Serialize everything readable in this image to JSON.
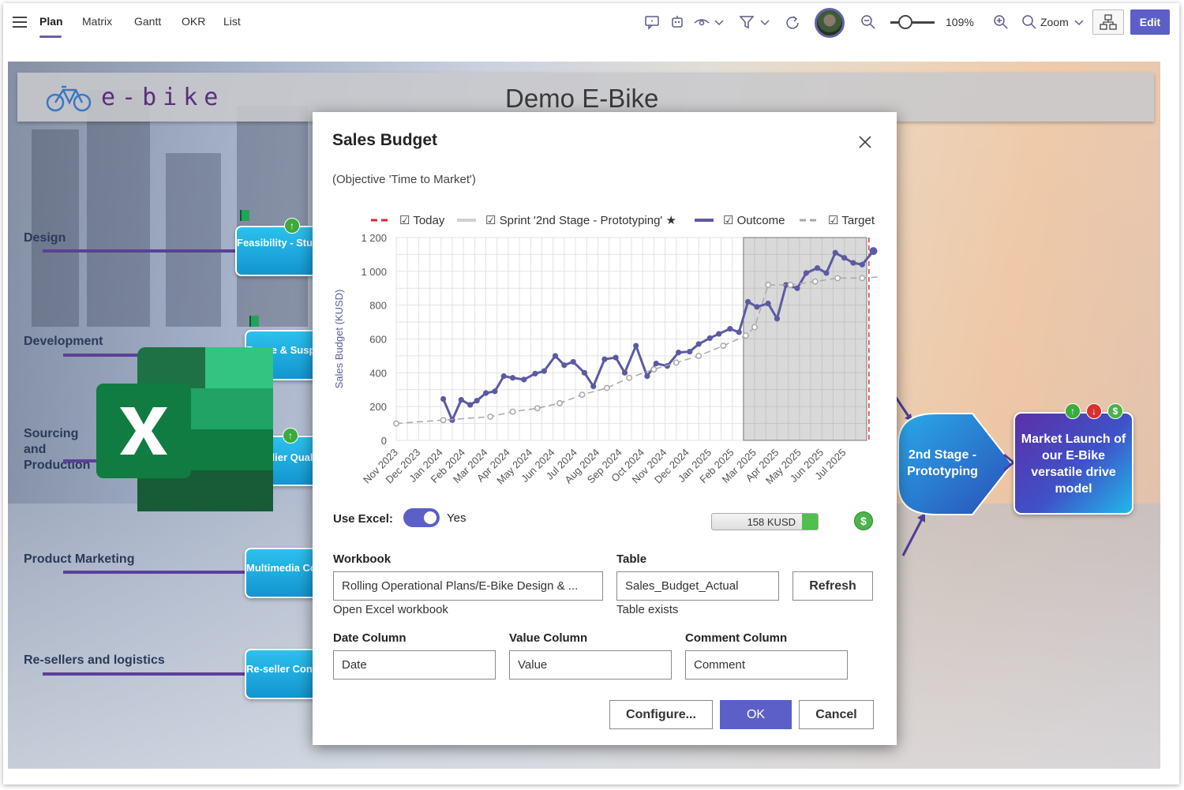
{
  "toolbar": {
    "tabs": [
      "Plan",
      "Matrix",
      "Gantt",
      "OKR",
      "List"
    ],
    "zoom_value": "109%",
    "zoom_label": "Zoom",
    "edit_label": "Edit"
  },
  "canvas": {
    "logo_text": "e-bike",
    "title": "Demo E-Bike",
    "lanes": [
      "Design",
      "Development",
      "Sourcing and Production",
      "Product Marketing",
      "Re-sellers and logistics"
    ],
    "cards": [
      {
        "text": "Feasibility - Study Prototyping"
      },
      {
        "text": "Frame & Suspension"
      },
      {
        "text": "Supplier Qualification"
      },
      {
        "text": "Multimedia Content"
      },
      {
        "text": "Re-seller Contracts"
      }
    ],
    "stage_node": "2nd Stage - Prototyping",
    "launch_node": "Market Launch of our E-Bike versatile drive model",
    "colors": {
      "card": "#1fa8df",
      "lane_line": "#5d3f99",
      "launch_start": "#5c2fa8",
      "launch_end": "#21b8ea"
    }
  },
  "dialog": {
    "title": "Sales Budget",
    "subtitle": "(Objective 'Time to Market')",
    "close_icon": "close-icon",
    "use_excel_label": "Use Excel:",
    "use_excel_value": "Yes",
    "budget_value": "158 KUSD",
    "budget_fill_fraction": 0.15,
    "workbook_label": "Workbook",
    "workbook_value": "Rolling Operational Plans/E-Bike Design & ...",
    "open_workbook_link": "Open Excel workbook",
    "table_label": "Table",
    "table_value": "Sales_Budget_Actual",
    "table_status": "Table exists",
    "refresh_label": "Refresh",
    "date_col_label": "Date Column",
    "date_col_value": "Date",
    "value_col_label": "Value Column",
    "value_col_value": "Value",
    "comment_col_label": "Comment Column",
    "comment_col_value": "Comment",
    "configure_label": "Configure...",
    "ok_label": "OK",
    "cancel_label": "Cancel"
  },
  "chart_data": {
    "type": "line",
    "ylabel": "Sales Budget (KUSD)",
    "ylim": [
      0,
      1200
    ],
    "yticks": [
      "0",
      "200",
      "400",
      "600",
      "800",
      "1 000",
      "1 200"
    ],
    "categories": [
      "Nov 2023",
      "Dec 2023",
      "Jan 2024",
      "Feb 2024",
      "Mar 2024",
      "Apr 2024",
      "May 2024",
      "Jun 2024",
      "Jul 2024",
      "Aug 2024",
      "Sep 2024",
      "Oct 2024",
      "Nov 2024",
      "Dec 2024",
      "Jan 2025",
      "Feb 2025",
      "Mar 2025",
      "Apr 2025",
      "May 2025",
      "Jun 2025",
      "Jul 2025"
    ],
    "legend": [
      {
        "label": "☑ Today",
        "color": "#d9252f",
        "style": "dashed"
      },
      {
        "label": "☑ Sprint '2nd Stage - Prototyping' ★",
        "color": "#d0d0d0",
        "style": "solid"
      },
      {
        "label": "☑ Outcome",
        "color": "#5b5ba3",
        "style": "solid"
      },
      {
        "label": "☑ Target",
        "color": "#a8a8a8",
        "style": "dashed"
      }
    ],
    "legend_position": "top",
    "grid": true,
    "sprint_range": [
      15.5,
      21.4
    ],
    "today_x": 21.4,
    "series": [
      {
        "name": "Outcome",
        "color": "#5b5ba3",
        "x": [
          2.1,
          2.5,
          2.9,
          3.3,
          3.6,
          4.0,
          4.4,
          4.8,
          5.2,
          5.7,
          6.2,
          6.6,
          7.1,
          7.5,
          7.9,
          8.4,
          8.8,
          9.3,
          9.8,
          10.2,
          10.7,
          11.2,
          11.6,
          12.1,
          12.6,
          13.1,
          13.5,
          14.0,
          14.4,
          14.9,
          15.3,
          15.7,
          16.1,
          16.6,
          17.0,
          17.4,
          17.9,
          18.3,
          18.8,
          19.2,
          19.6,
          20.0,
          20.4,
          20.8,
          21.3
        ],
        "y": [
          245,
          120,
          240,
          210,
          235,
          280,
          290,
          380,
          370,
          360,
          395,
          410,
          500,
          445,
          465,
          400,
          320,
          480,
          490,
          400,
          560,
          380,
          455,
          440,
          520,
          525,
          570,
          605,
          630,
          660,
          640,
          820,
          790,
          810,
          720,
          920,
          900,
          990,
          1020,
          990,
          1110,
          1080,
          1050,
          1040,
          1120
        ]
      },
      {
        "name": "Target",
        "color": "#a8a8a8",
        "x": [
          0,
          2.1,
          4.2,
          5.2,
          6.3,
          7.3,
          8.3,
          9.4,
          10.4,
          11.5,
          12.5,
          13.5,
          14.6,
          15.6,
          16.0,
          16.6,
          17.6,
          18.7,
          19.7,
          20.8,
          21.8
        ],
        "y": [
          100,
          120,
          140,
          170,
          190,
          220,
          270,
          310,
          370,
          420,
          460,
          500,
          560,
          620,
          670,
          920,
          920,
          940,
          960,
          960,
          970
        ]
      }
    ]
  }
}
